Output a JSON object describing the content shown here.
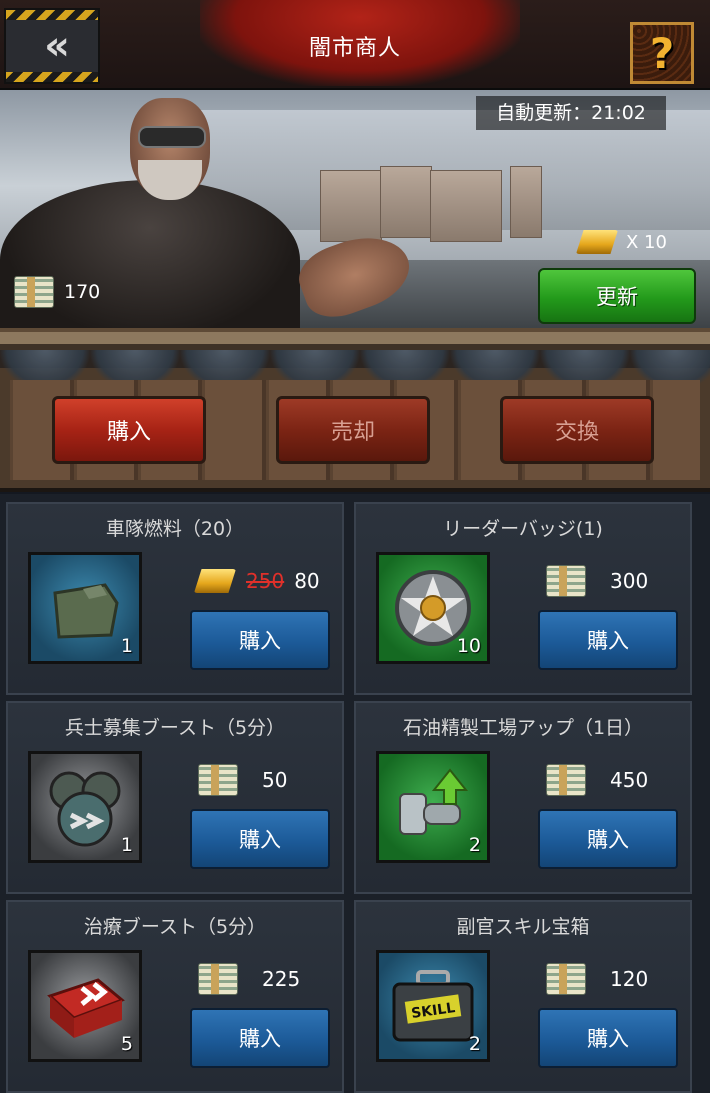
{
  "header": {
    "title": "闇市商人",
    "back_icon": "double-chevron-left-icon",
    "help_label": "?"
  },
  "shop": {
    "auto_refresh": "自動更新：21:02",
    "gold_cost": "X 10",
    "cash": "170",
    "refresh_label": "更新"
  },
  "tabs": [
    {
      "label": "購入",
      "active": true
    },
    {
      "label": "売却",
      "active": false
    },
    {
      "label": "交換",
      "active": false
    }
  ],
  "items": [
    {
      "name": "車隊燃料（20）",
      "icon": "fuel-canister-icon",
      "count": "1",
      "currency": "gold",
      "old_price": "250",
      "price": "80",
      "buy": "購入"
    },
    {
      "name": "リーダーバッジ(1)",
      "icon": "leader-badge-icon",
      "count": "10",
      "currency": "cash",
      "price": "300",
      "buy": "購入"
    },
    {
      "name": "兵士募集ブースト（5分）",
      "icon": "soldier-helmet-icon",
      "count": "1",
      "currency": "cash",
      "price": "50",
      "buy": "購入"
    },
    {
      "name": "石油精製工場アップ（1日）",
      "icon": "oil-barrel-upgrade-icon",
      "count": "2",
      "currency": "cash",
      "price": "450",
      "buy": "購入"
    },
    {
      "name": "治療ブースト（5分）",
      "icon": "medkit-icon",
      "count": "5",
      "currency": "cash",
      "price": "225",
      "buy": "購入"
    },
    {
      "name": "副官スキル宝箱",
      "icon": "skill-chest-icon",
      "count": "2",
      "currency": "cash",
      "price": "120",
      "buy": "購入",
      "chest_label": "SKILL"
    }
  ]
}
